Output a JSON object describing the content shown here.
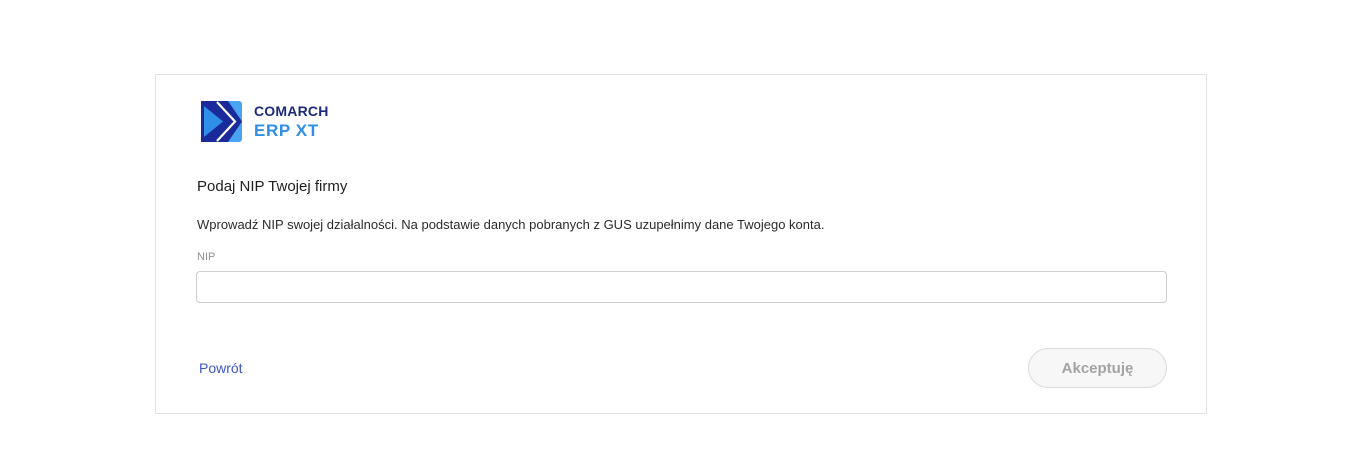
{
  "logo": {
    "brand": "COMARCH",
    "product": "ERP XT",
    "colors": {
      "dark": "#1b2a7a",
      "light": "#2f8fe6"
    }
  },
  "form": {
    "title": "Podaj NIP Twojej firmy",
    "description": "Wprowadź NIP swojej działalności. Na podstawie danych pobranych z GUS uzupełnimy dane Twojego konta.",
    "nip_label": "NIP",
    "nip_value": "",
    "nip_placeholder": ""
  },
  "actions": {
    "back_label": "Powrót",
    "accept_label": "Akceptuję",
    "accept_disabled": true
  },
  "colors": {
    "link": "#3f56c4",
    "disabled_text": "#a3a3a3"
  }
}
